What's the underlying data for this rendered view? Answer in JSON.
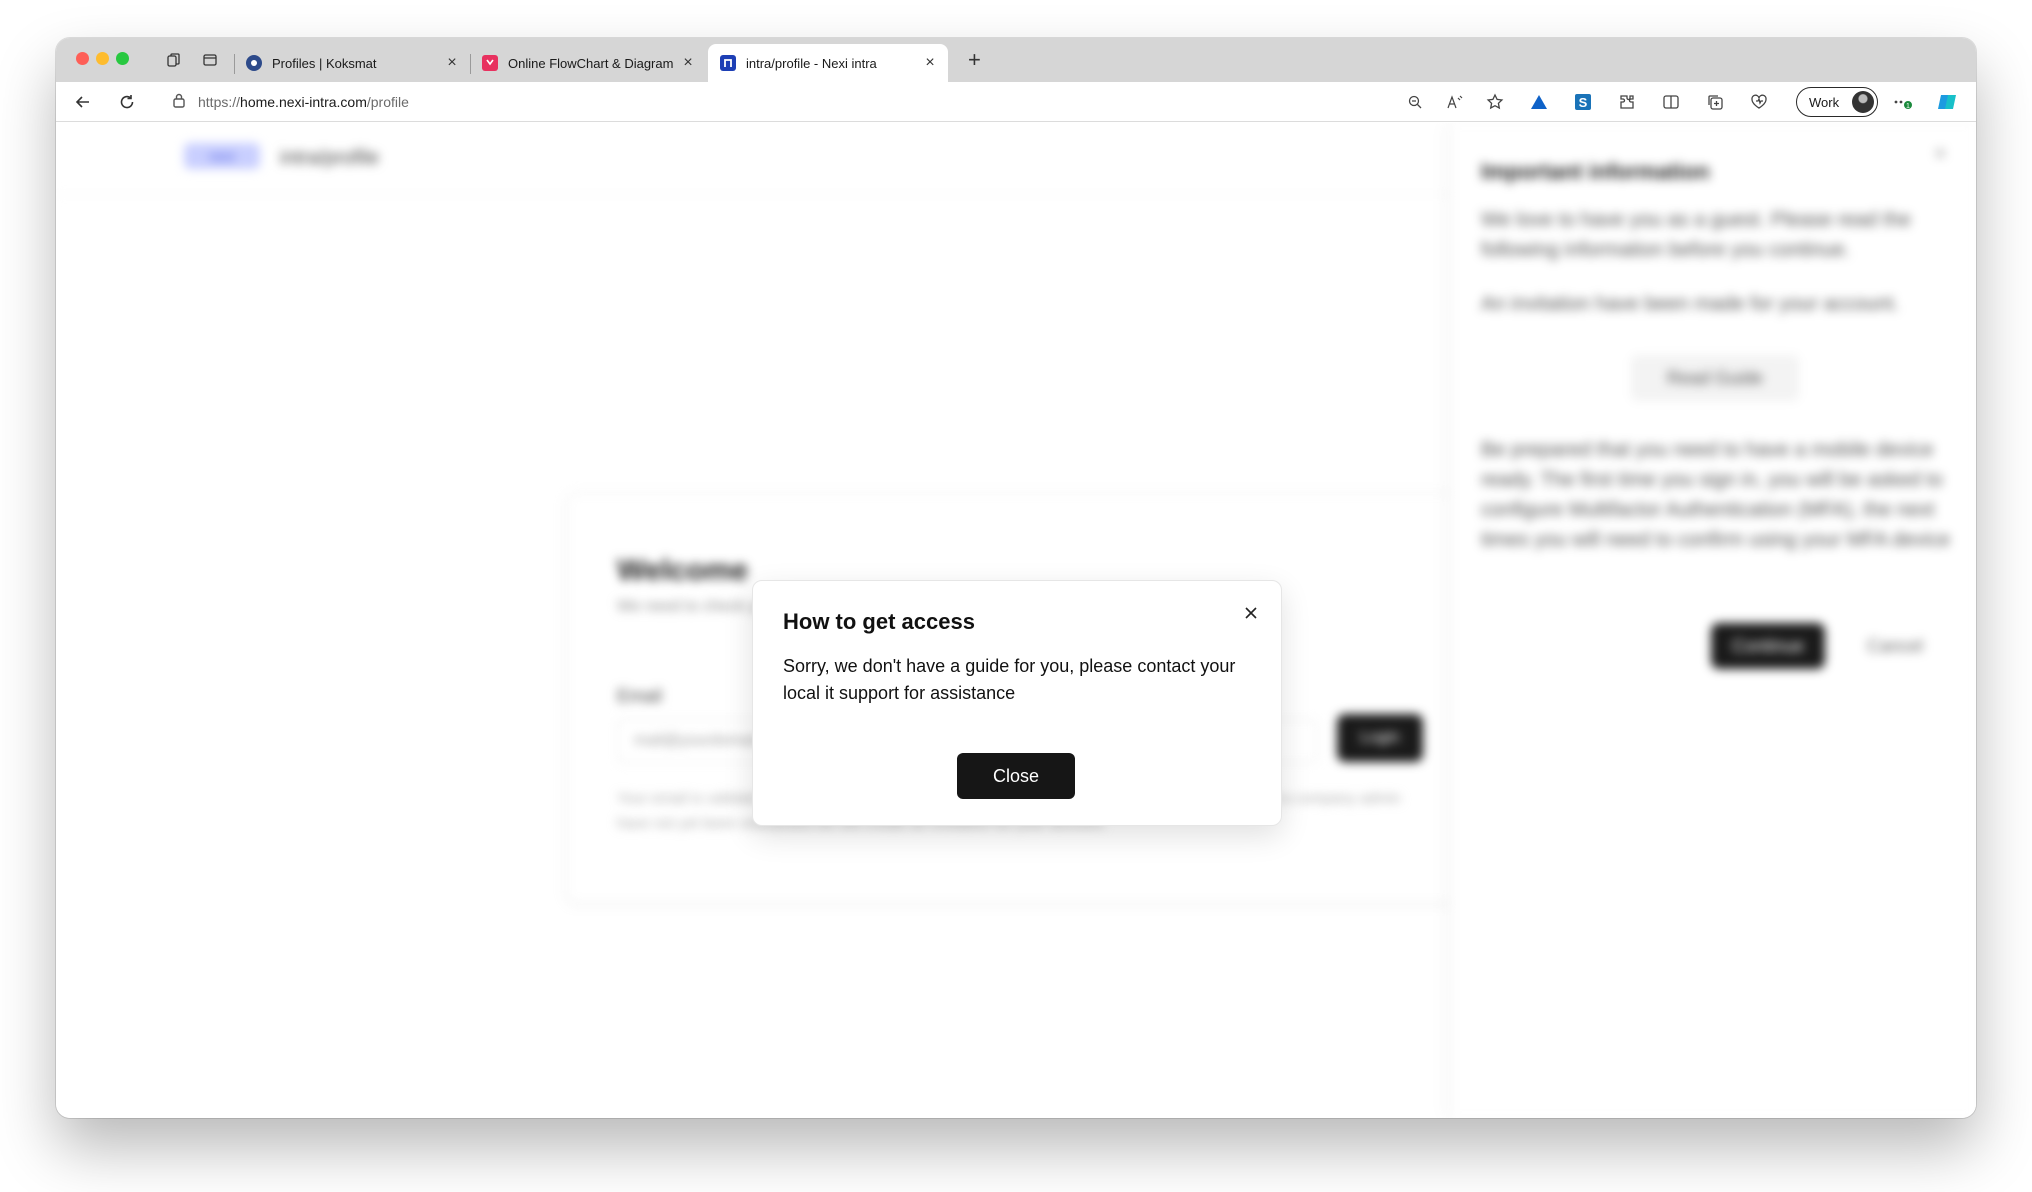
{
  "browser": {
    "tabs": [
      {
        "title": "Profiles | Koksmat",
        "favicon_color": "#2d4a8a"
      },
      {
        "title": "Online FlowChart & Diagrams E",
        "favicon_color": "#e8315f"
      },
      {
        "title": "intra/profile - Nexi intra",
        "favicon_color": "#1d3fb5"
      }
    ],
    "url_prefix": "https://",
    "url_host": "home.nexi-intra.com",
    "url_path": "/profile",
    "profile_label": "Work"
  },
  "page": {
    "brand": "nexi",
    "path": "intra/profile",
    "card": {
      "title": "Welcome",
      "subtitle": "We need to check your email",
      "email_label": "Email",
      "email_placeholder": "mail@yourdomain.com",
      "login_label": "Login",
      "help_text": "Your email is validated against our own database. If we cannot find yours, you'll see a message and a company admin have not yet been onboarded we will create an invitation for your account."
    },
    "side_panel": {
      "title": "Important information",
      "intro": "We love to have you as a guest. Please read the following information before you continue.",
      "invite": "An invitation have been made for your account.",
      "guide_button": "Read Guide",
      "mfa": "Be prepared that you need to have a mobile device ready. The first time you sign in, you will be asked to configure Multifactor Authentication (MFA), the next times you will need to confirm using your MFA device",
      "continue_button": "Continue",
      "cancel_button": "Cancel"
    }
  },
  "modal": {
    "title": "How to get access",
    "body": "Sorry, we don't have a guide for you, please contact your local it support for assistance",
    "close_button": "Close"
  }
}
